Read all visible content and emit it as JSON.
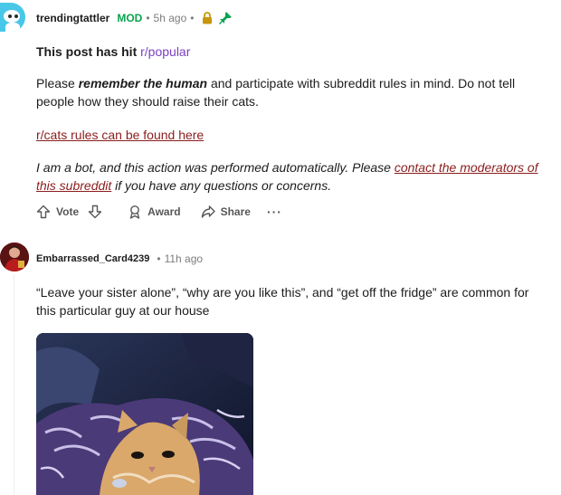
{
  "comment1": {
    "username": "trendingtattler",
    "mod_badge": "MOD",
    "separator": "•",
    "time": "5h ago",
    "hit_prefix": "This post has hit",
    "hit_link": "r/popular",
    "para_before": "Please",
    "para_bold": "remember the human",
    "para_after": "and participate with subreddit rules in mind. Do not tell people how they should raise their cats.",
    "rules_link": "r/cats rules can be found here",
    "bot_before": "I am a bot, and this action was performed automatically. Please",
    "bot_link": "contact the moderators of this subreddit",
    "bot_after": "if you have any questions or concerns.",
    "icons": [
      "lock-icon",
      "pin-icon"
    ],
    "colors": {
      "mod": "#0aa34f",
      "lock": "#c8960c",
      "pin": "#0aa34f",
      "link": "#8b1d1d",
      "popular": "#7b3fbf"
    }
  },
  "actions": {
    "vote": "Vote",
    "award": "Award",
    "share": "Share",
    "more": "···"
  },
  "comment2": {
    "username": "Embarrassed_Card4239",
    "separator": "•",
    "time": "11h ago",
    "body": "“Leave your sister alone”, “why are you like this”, and “get off the fridge” are common for this particular guy at our house"
  }
}
